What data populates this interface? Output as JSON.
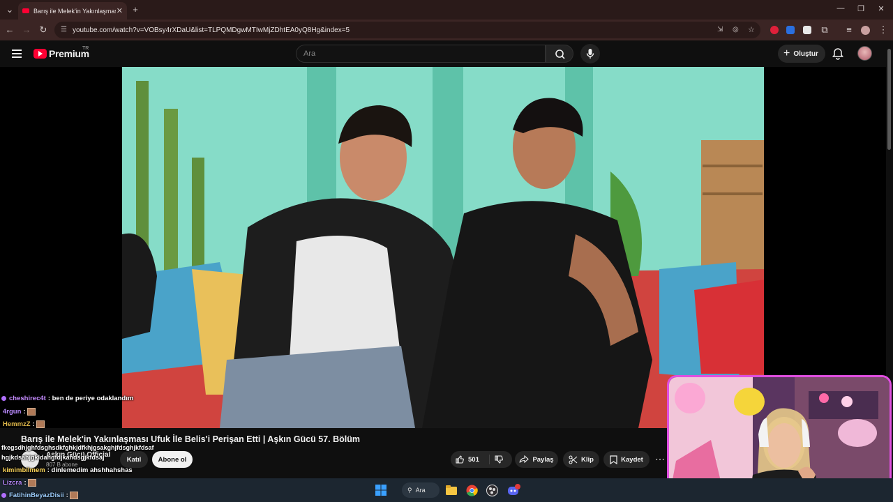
{
  "browser": {
    "tab_title": "Barış ile Melek'in Yakınlaşması Ufuk İle Belis'i Perişan Etti",
    "url": "youtube.com/watch?v=VOBsy4rXDaU&list=TLPQMDgwMTIwMjZDhtEA0yQ8Hg&index=5",
    "new_tab": "+",
    "close_tab": "✕"
  },
  "youtube": {
    "logo_text": "Premium",
    "country_code": "TR",
    "search_placeholder": "Ara",
    "create_label": "Oluştur"
  },
  "video": {
    "title": "Barış ile Melek'in Yakınlaşması Ufuk İle Belis'i Perişan Etti | Aşkın Gücü 57. Bölüm",
    "channel_name": "Aşkın Gücü Official",
    "subscribers": "807 B abone",
    "join_label": "Katıl",
    "subscribe_label": "Abone ol",
    "like_count": "501",
    "share_label": "Paylaş",
    "clip_label": "Klip",
    "save_label": "Kaydet"
  },
  "chat": [
    {
      "user": "cheshirec4t",
      "message": ": ben de periye odaklandım",
      "color": "#c58bff"
    },
    {
      "user": "4rgun",
      "message": ":",
      "color": "#b98aff",
      "emote": true
    },
    {
      "user": "HemmzZ",
      "message": ":",
      "color": "#e0b84a",
      "emote": true
    },
    {
      "user": "",
      "message": "fkegsdhjghfdsghsdkfghkjdfkhjgsakghjfdsghjkfdsaf",
      "color": "#ffffff"
    },
    {
      "user": "",
      "message": "hgjkdsahjgkldahgfdjkahdsgjkfdsaj",
      "color": "#ffffff"
    },
    {
      "user": "kimimbilmem",
      "message": ": dinlemedim ahshhahshas",
      "color": "#ffd75a"
    },
    {
      "user": "Lizcra",
      "message": ":",
      "color": "#b98aff",
      "emote": true
    },
    {
      "user": "FatihinBeyazDisii",
      "message": ":",
      "color": "#9ecfff",
      "emote": true
    }
  ],
  "taskbar": {
    "search_label": "Ara"
  }
}
